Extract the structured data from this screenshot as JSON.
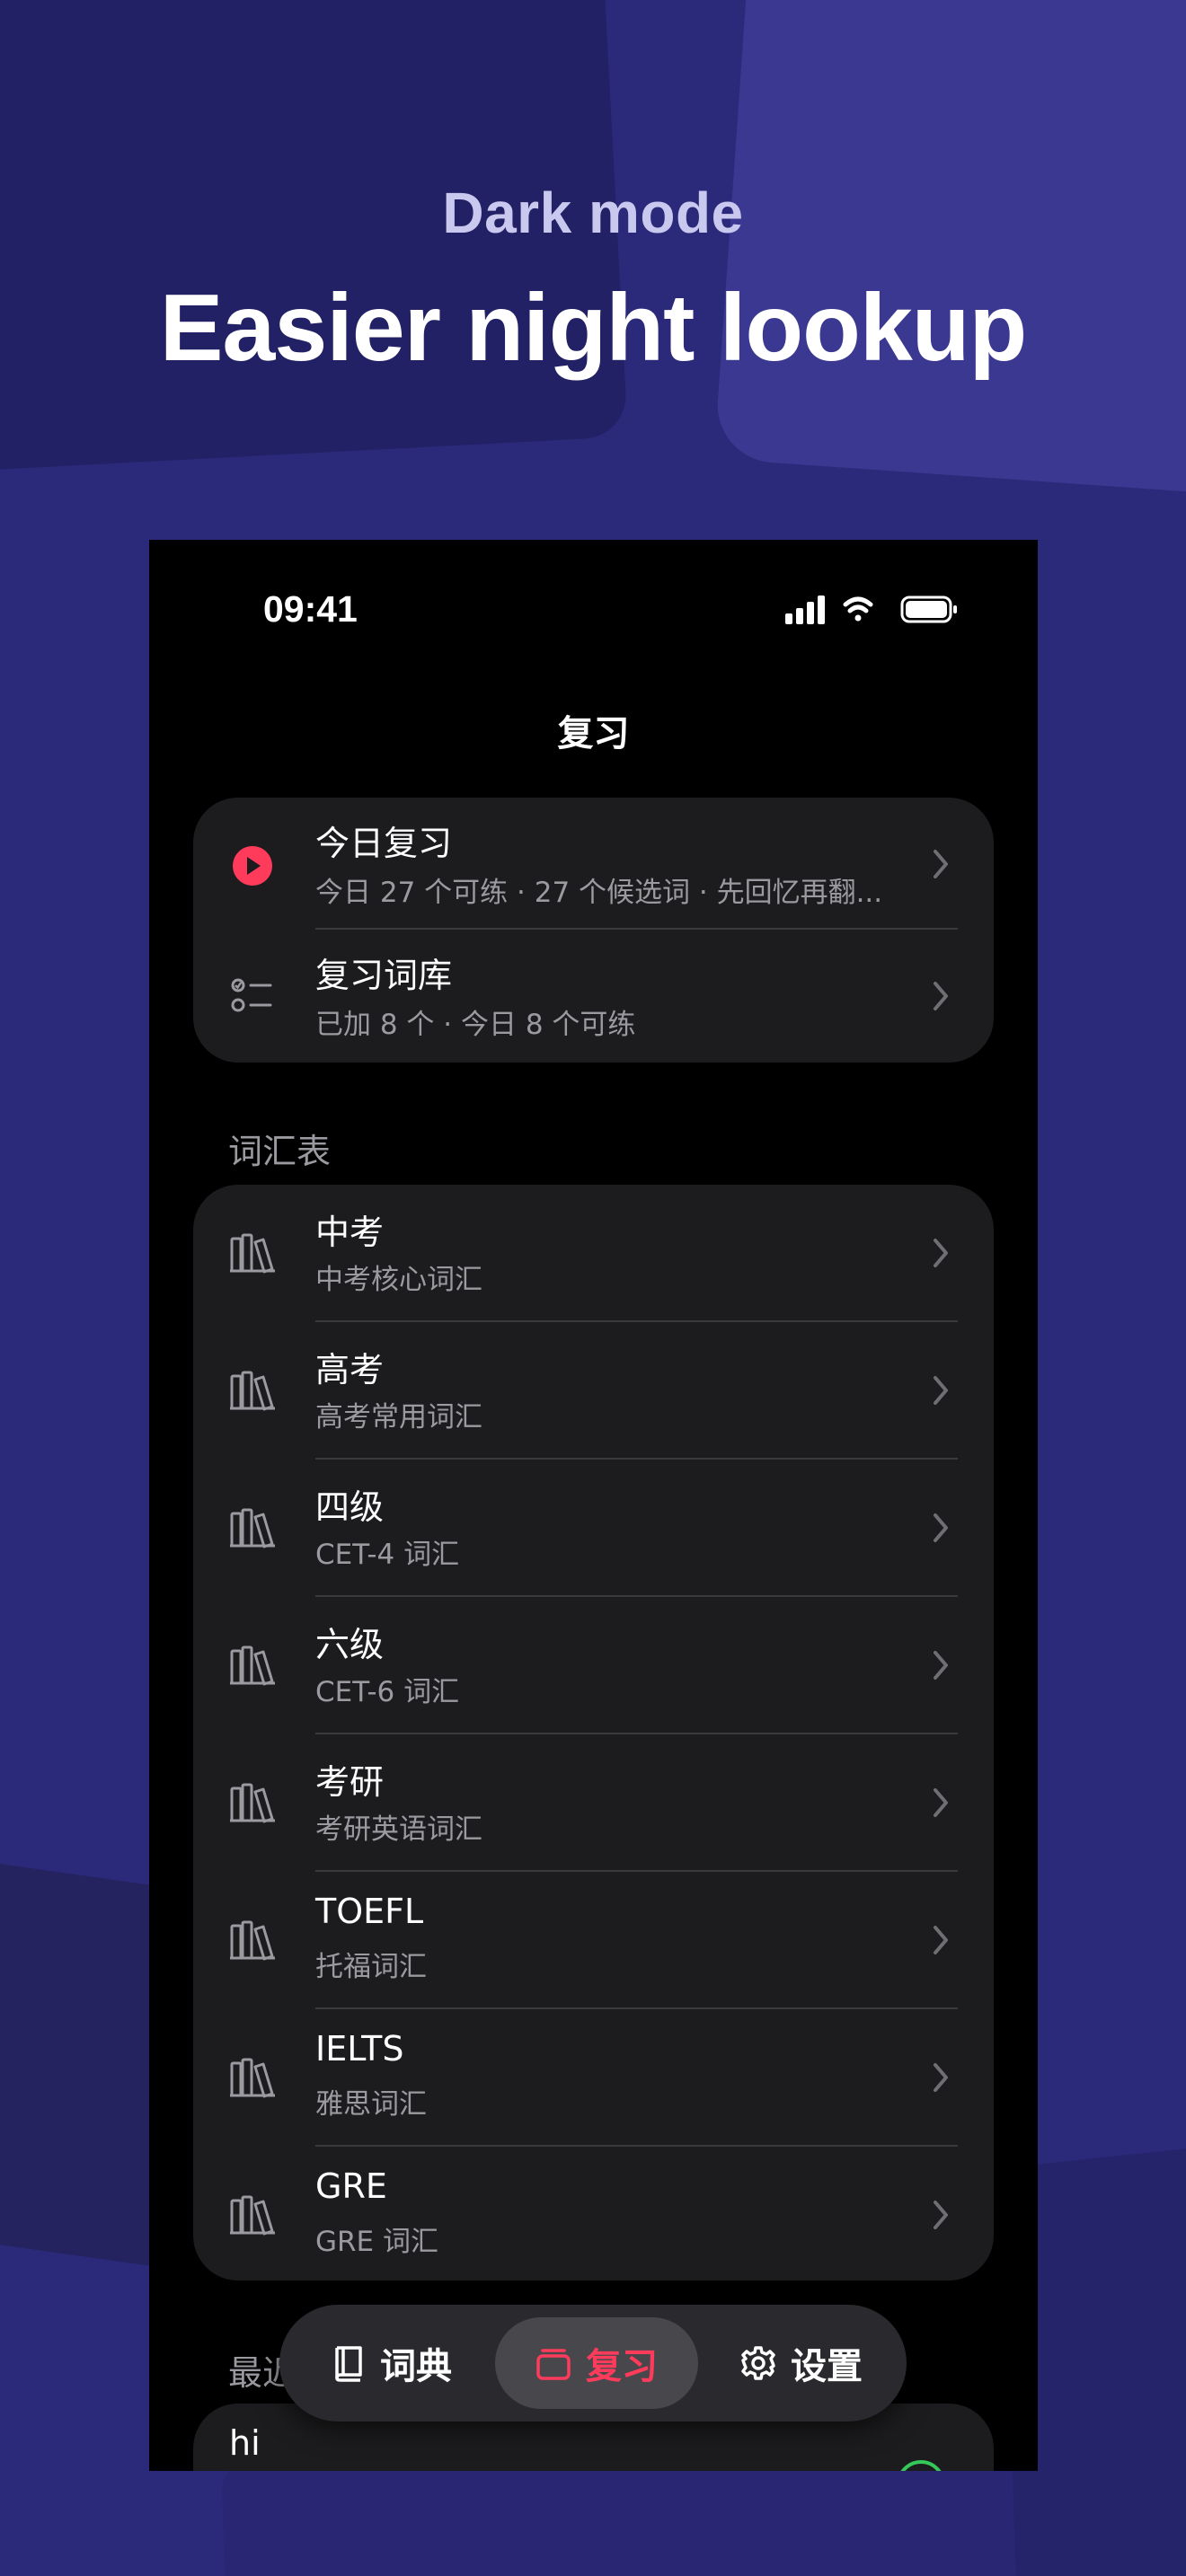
{
  "promo": {
    "subtitle": "Dark mode",
    "title": "Easier night lookup"
  },
  "status_bar": {
    "time": "09:41",
    "icons": [
      "signal-icon",
      "wifi-icon",
      "battery-icon"
    ]
  },
  "nav": {
    "title": "复习"
  },
  "review_section": {
    "items": [
      {
        "icon": "play-circle-icon",
        "title": "今日复习",
        "subtitle": "今日 27 个可练 · 27 个候选词 · 先回忆再翻..."
      },
      {
        "icon": "checklist-icon",
        "title": "复习词库",
        "subtitle": "已加 8 个 · 今日 8 个可练"
      }
    ]
  },
  "vocab_section": {
    "header": "词汇表",
    "items": [
      {
        "icon": "books-icon",
        "title": "中考",
        "subtitle": "中考核心词汇"
      },
      {
        "icon": "books-icon",
        "title": "高考",
        "subtitle": "高考常用词汇"
      },
      {
        "icon": "books-icon",
        "title": "四级",
        "subtitle": "CET-4 词汇"
      },
      {
        "icon": "books-icon",
        "title": "六级",
        "subtitle": "CET-6 词汇"
      },
      {
        "icon": "books-icon",
        "title": "考研",
        "subtitle": "考研英语词汇"
      },
      {
        "icon": "books-icon",
        "title": "TOEFL",
        "subtitle": "托福词汇"
      },
      {
        "icon": "books-icon",
        "title": "IELTS",
        "subtitle": "雅思词汇"
      },
      {
        "icon": "books-icon",
        "title": "GRE",
        "subtitle": "GRE 词汇"
      }
    ]
  },
  "recent_section": {
    "header": "最近",
    "items": [
      {
        "word": "hi",
        "action_icon": "plus-circle-icon"
      }
    ]
  },
  "tab_bar": {
    "tabs": [
      {
        "label": "词典",
        "icon": "book-icon",
        "active": false
      },
      {
        "label": "复习",
        "icon": "cards-icon",
        "active": true
      },
      {
        "label": "设置",
        "icon": "gear-icon",
        "active": false
      }
    ]
  },
  "colors": {
    "accent": "#ff3b5c",
    "card_bg": "#1c1c1e",
    "secondary_text": "#9a9aa0",
    "add_green": "#34c759",
    "background_indigo": "#2b2a7a"
  }
}
